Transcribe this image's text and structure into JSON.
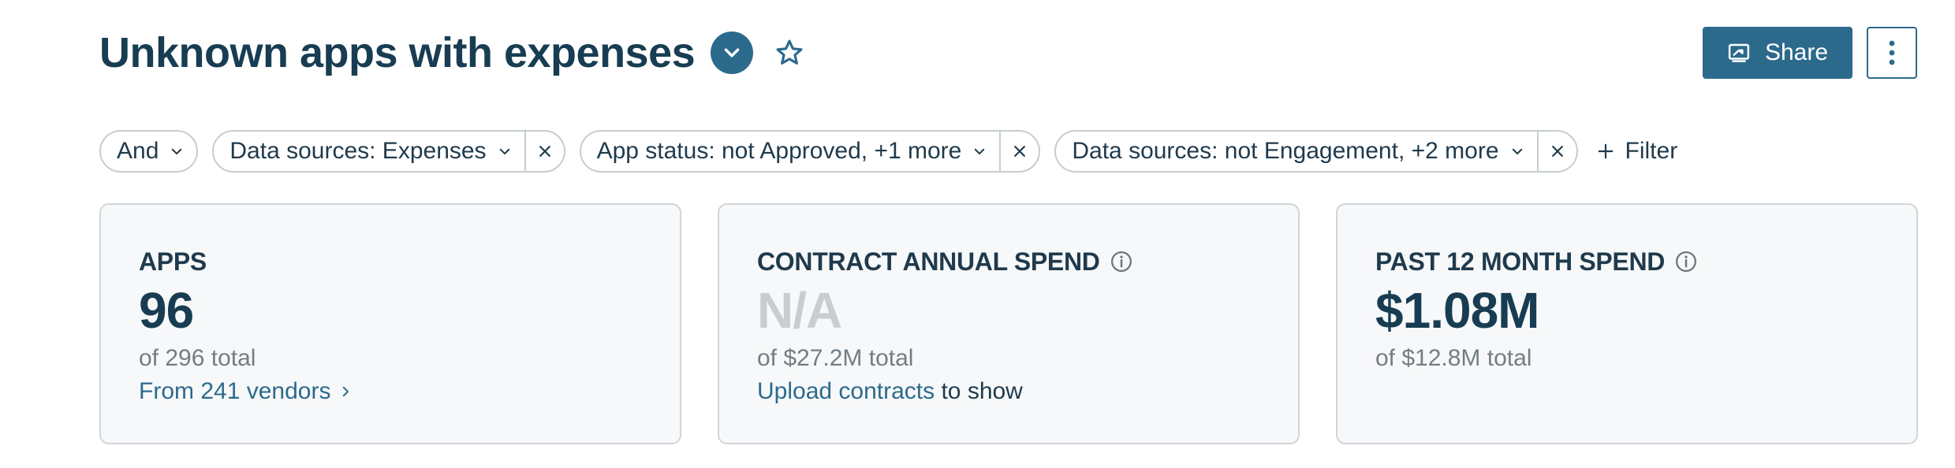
{
  "header": {
    "title": "Unknown apps with expenses",
    "share_label": "Share"
  },
  "filters": {
    "conjunction": "And",
    "chips": [
      {
        "label": "Data sources: Expenses"
      },
      {
        "label": "App status: not Approved, +1 more"
      },
      {
        "label": "Data sources: not Engagement, +2 more"
      }
    ],
    "add_label": "Filter"
  },
  "cards": {
    "apps": {
      "label": "APPS",
      "value": "96",
      "sub": "of 296 total",
      "link": "From 241 vendors"
    },
    "contract": {
      "label": "CONTRACT ANNUAL SPEND",
      "value": "N/A",
      "sub": "of $27.2M total",
      "link": "Upload contracts",
      "link_suffix": " to show"
    },
    "past12": {
      "label": "PAST 12 MONTH SPEND",
      "value": "$1.08M",
      "sub": "of $12.8M total"
    }
  },
  "colors": {
    "accent": "#2c6a8c",
    "title": "#183d52",
    "muted_value": "#c9cdd1",
    "card_bg": "#f7f8f9"
  }
}
